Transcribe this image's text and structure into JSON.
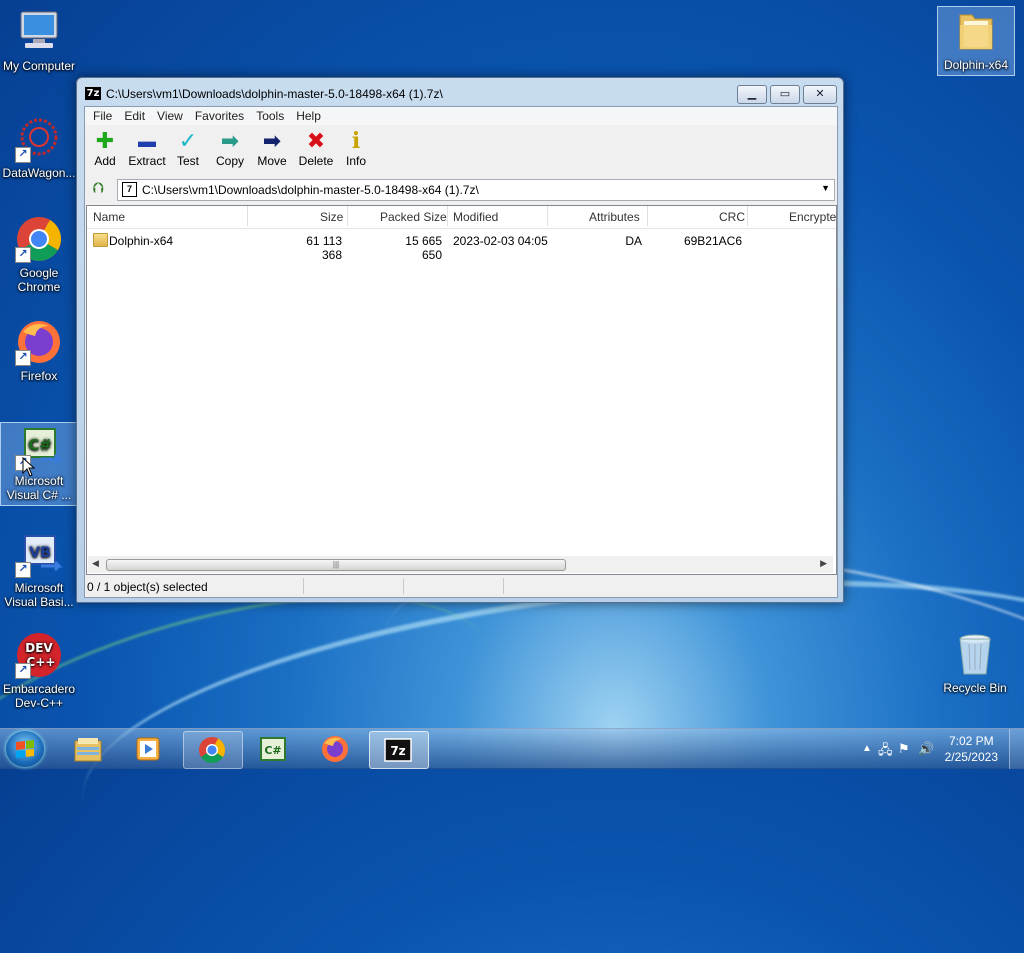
{
  "desktop": {
    "icons_left": [
      {
        "label": "My Computer"
      },
      {
        "label": "DataWagon..."
      },
      {
        "label": "Google Chrome"
      },
      {
        "label": "Firefox"
      },
      {
        "label": "Microsoft Visual C# ..."
      },
      {
        "label": "Microsoft Visual Basi..."
      },
      {
        "label": "Embarcadero Dev-C++"
      }
    ],
    "folder_icon": {
      "label": "Dolphin-x64"
    },
    "recycle_bin": {
      "label": "Recycle Bin"
    }
  },
  "window": {
    "title": "C:\\Users\\vm1\\Downloads\\dolphin-master-5.0-18498-x64 (1).7z\\",
    "app_icon_text": "7z",
    "menu": [
      "File",
      "Edit",
      "View",
      "Favorites",
      "Tools",
      "Help"
    ],
    "toolbar": [
      {
        "label": "Add",
        "icon": "plus-icon",
        "glyph": "✚",
        "color": "#1ea81e"
      },
      {
        "label": "Extract",
        "icon": "minus-icon",
        "glyph": "▬",
        "color": "#1f3fae"
      },
      {
        "label": "Test",
        "icon": "check-icon",
        "glyph": "✓",
        "color": "#1cb8c8"
      },
      {
        "label": "Copy",
        "icon": "copy-arrow-icon",
        "glyph": "➡",
        "color": "#2a9a8a"
      },
      {
        "label": "Move",
        "icon": "move-arrow-icon",
        "glyph": "➡",
        "color": "#13236e"
      },
      {
        "label": "Delete",
        "icon": "delete-x-icon",
        "glyph": "✖",
        "color": "#d8101a"
      },
      {
        "label": "Info",
        "icon": "info-icon",
        "glyph": "i",
        "color": "#c9a400"
      }
    ],
    "address": "C:\\Users\\vm1\\Downloads\\dolphin-master-5.0-18498-x64 (1).7z\\",
    "columns": [
      "Name",
      "Size",
      "Packed Size",
      "Modified",
      "Attributes",
      "CRC",
      "Encrypte"
    ],
    "rows": [
      {
        "name": "Dolphin-x64",
        "size": "61 113 368",
        "packed": "15 665 650",
        "modified": "2023-02-03 04:05",
        "attributes": "DA",
        "crc": "69B21AC6",
        "encrypted": ""
      }
    ],
    "status": "0 / 1 object(s) selected"
  },
  "taskbar": {
    "apps": [
      {
        "name": "explorer",
        "state": "normal"
      },
      {
        "name": "media-player",
        "state": "normal"
      },
      {
        "name": "chrome",
        "state": "open"
      },
      {
        "name": "visual-csharp",
        "state": "normal"
      },
      {
        "name": "firefox",
        "state": "normal"
      },
      {
        "name": "7zip",
        "state": "active"
      }
    ],
    "time": "7:02 PM",
    "date": "2/25/2023"
  },
  "colors": {
    "accent": "#1a6fc4",
    "titlebar": "#c8dcef"
  }
}
